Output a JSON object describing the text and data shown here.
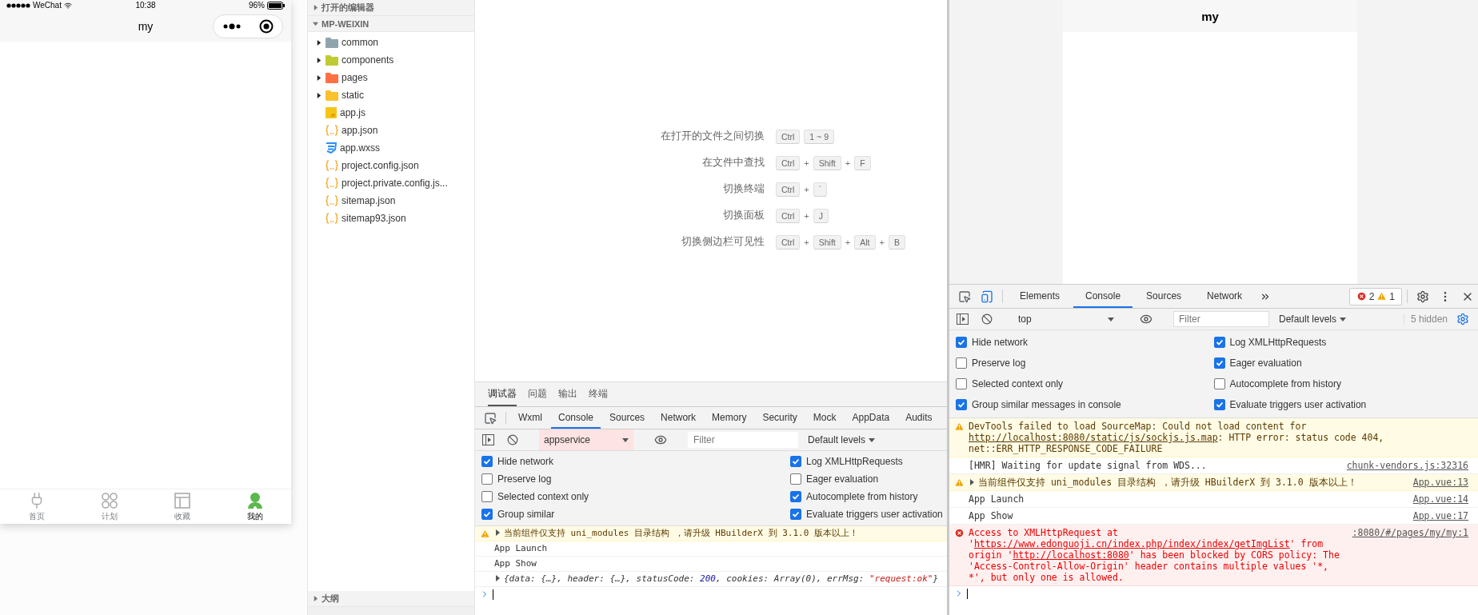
{
  "simulator": {
    "status_bar": {
      "carrier": "WeChat",
      "time": "10:38",
      "battery": "96%"
    },
    "nav_title": "my",
    "tab_bar": [
      {
        "label": "首页",
        "selected": false
      },
      {
        "label": "计划",
        "selected": false
      },
      {
        "label": "收藏",
        "selected": false
      },
      {
        "label": "我的",
        "selected": true
      }
    ]
  },
  "explorer": {
    "open_editors": {
      "title": "打开的编辑器",
      "expanded": false
    },
    "project": {
      "title": "MP-WEIXIN",
      "expanded": true
    },
    "items": [
      {
        "name": "common",
        "kind": "folder",
        "expanded": false,
        "color": "#90a4ae"
      },
      {
        "name": "components",
        "kind": "folder",
        "expanded": false,
        "color": "#c0ca33"
      },
      {
        "name": "pages",
        "kind": "folder",
        "expanded": false,
        "color": "#ff7043"
      },
      {
        "name": "static",
        "kind": "folder",
        "expanded": false,
        "color": "#fbc02d"
      },
      {
        "name": "app.js",
        "kind": "js"
      },
      {
        "name": "app.json",
        "kind": "json"
      },
      {
        "name": "app.wxss",
        "kind": "css"
      },
      {
        "name": "project.config.json",
        "kind": "json"
      },
      {
        "name": "project.private.config.js...",
        "kind": "json"
      },
      {
        "name": "sitemap.json",
        "kind": "json"
      },
      {
        "name": "sitemap93.json",
        "kind": "json"
      }
    ],
    "outline": {
      "title": "大纲",
      "expanded": false
    }
  },
  "editor": {
    "shortcuts": [
      {
        "label": "在打开的文件之间切换",
        "keys": [
          "Ctrl",
          "1 ~ 9"
        ]
      },
      {
        "label": "在文件中查找",
        "keys": [
          "Ctrl",
          "Shift",
          "F"
        ],
        "separator": "+"
      },
      {
        "label": "切换终端",
        "keys": [
          "Ctrl",
          "`"
        ],
        "separator": "+"
      },
      {
        "label": "切换面板",
        "keys": [
          "Ctrl",
          "J"
        ],
        "separator": "+"
      },
      {
        "label": "切换侧边栏可见性",
        "keys": [
          "Ctrl",
          "Shift",
          "Alt",
          "B"
        ],
        "separator": "+"
      }
    ]
  },
  "bottom_panel": {
    "tabs": [
      {
        "label": "调试器",
        "selected": true
      },
      {
        "label": "问题",
        "selected": false
      },
      {
        "label": "输出",
        "selected": false
      },
      {
        "label": "终端",
        "selected": false
      }
    ],
    "devtools": {
      "tabs": [
        {
          "label": "Wxml",
          "selected": false
        },
        {
          "label": "Console",
          "selected": true
        },
        {
          "label": "Sources",
          "selected": false
        },
        {
          "label": "Network",
          "selected": false
        },
        {
          "label": "Memory",
          "selected": false
        },
        {
          "label": "Security",
          "selected": false
        },
        {
          "label": "Mock",
          "selected": false
        },
        {
          "label": "AppData",
          "selected": false
        },
        {
          "label": "Audits",
          "selected": false
        }
      ],
      "context": "appservice",
      "context_highlighted": true,
      "filter_placeholder": "Filter",
      "levels": "Default levels",
      "settings_open": true,
      "settings": [
        {
          "label": "Hide network",
          "checked": true
        },
        {
          "label": "Log XMLHttpRequests",
          "checked": true
        },
        {
          "label": "Preserve log",
          "checked": false
        },
        {
          "label": "Eager evaluation",
          "checked": false
        },
        {
          "label": "Selected context only",
          "checked": false
        },
        {
          "label": "Autocomplete from history",
          "checked": true
        },
        {
          "label": "Group similar",
          "checked": true
        },
        {
          "label": "Evaluate triggers user activation",
          "checked": true
        }
      ],
      "messages": [
        {
          "kind": "warning",
          "expandable": true,
          "parts": [
            {
              "kind": "plain",
              "text": "当前组件仅支持 uni_modules 目录结构 ，请升级 HBuilderX 到 3.1.0 版本以上！"
            }
          ]
        },
        {
          "kind": "log",
          "expandable": false,
          "parts": [
            {
              "kind": "plain",
              "text": "App Launch"
            }
          ]
        },
        {
          "kind": "log",
          "expandable": false,
          "parts": [
            {
              "kind": "plain",
              "text": "App Show"
            }
          ]
        },
        {
          "kind": "object",
          "expandable": true,
          "parts": [
            {
              "kind": "plain",
              "text": "{data: {…}, header: {…}, statusCode: "
            },
            {
              "kind": "number",
              "text": "200"
            },
            {
              "kind": "plain",
              "text": ", cookies: Array(0), errMsg: "
            },
            {
              "kind": "string",
              "text": "\"request:ok\""
            },
            {
              "kind": "plain",
              "text": "}"
            }
          ]
        }
      ]
    }
  },
  "preview": {
    "title": "my"
  },
  "devtools": {
    "tabs": [
      {
        "label": "Elements",
        "selected": false
      },
      {
        "label": "Console",
        "selected": true
      },
      {
        "label": "Sources",
        "selected": false
      },
      {
        "label": "Network",
        "selected": false
      }
    ],
    "tabs_overflow": true,
    "error_count": "2",
    "warning_count": "1",
    "context": "top",
    "context_highlighted": false,
    "filter_placeholder": "Filter",
    "levels": "Default levels",
    "hidden_count": "5 hidden",
    "settings_open": true,
    "settings": [
      {
        "label": "Hide network",
        "checked": true
      },
      {
        "label": "Log XMLHttpRequests",
        "checked": true
      },
      {
        "label": "Preserve log",
        "checked": false
      },
      {
        "label": "Eager evaluation",
        "checked": true
      },
      {
        "label": "Selected context only",
        "checked": false
      },
      {
        "label": "Autocomplete from history",
        "checked": false
      },
      {
        "label": "Group similar messages in console",
        "checked": true
      },
      {
        "label": "Evaluate triggers user activation",
        "checked": true
      }
    ],
    "messages": [
      {
        "kind": "warning",
        "expandable": false,
        "parts": [
          {
            "kind": "plain",
            "text": "DevTools failed to load SourceMap: Could not load content for "
          },
          {
            "kind": "link",
            "text": "http://localhost:8080/"
          },
          {
            "kind": "link",
            "text": "static/js/sockjs.js.map"
          },
          {
            "kind": "plain",
            "text": ": HTTP error: status code 404, net::ERR_HTTP_RESPONSE_CODE_FAILURE"
          }
        ]
      },
      {
        "kind": "log",
        "expandable": false,
        "source": "chunk-vendors.js:32316",
        "parts": [
          {
            "kind": "plain",
            "text": "[HMR] Waiting for update signal from WDS..."
          }
        ]
      },
      {
        "kind": "warning",
        "expandable": true,
        "source": "App.vue:13",
        "parts": [
          {
            "kind": "plain",
            "text": "当前组件仅支持 uni_modules 目录结构 ，请升级 HBuilderX 到 3.1.0 版本以上！"
          }
        ]
      },
      {
        "kind": "log",
        "expandable": false,
        "source": "App.vue:14",
        "parts": [
          {
            "kind": "plain",
            "text": "App Launch"
          }
        ]
      },
      {
        "kind": "log",
        "expandable": false,
        "source": "App.vue:17",
        "parts": [
          {
            "kind": "plain",
            "text": "App Show"
          }
        ]
      },
      {
        "kind": "error",
        "expandable": false,
        "source": ":8080/#/pages/my/my:1",
        "parts": [
          {
            "kind": "plain",
            "text": "Access to XMLHttpRequest at '"
          },
          {
            "kind": "link",
            "text": "https://www.edonguoji.cn/index.php/index/index/getImgList"
          },
          {
            "kind": "plain",
            "text": "' from origin '"
          },
          {
            "kind": "link",
            "text": "http://localhost:8080"
          },
          {
            "kind": "plain",
            "text": "' has been blocked by CORS policy: The 'Access-Control-Allow-Origin' header contains multiple values '*, *', but only one is allowed."
          }
        ]
      }
    ]
  }
}
